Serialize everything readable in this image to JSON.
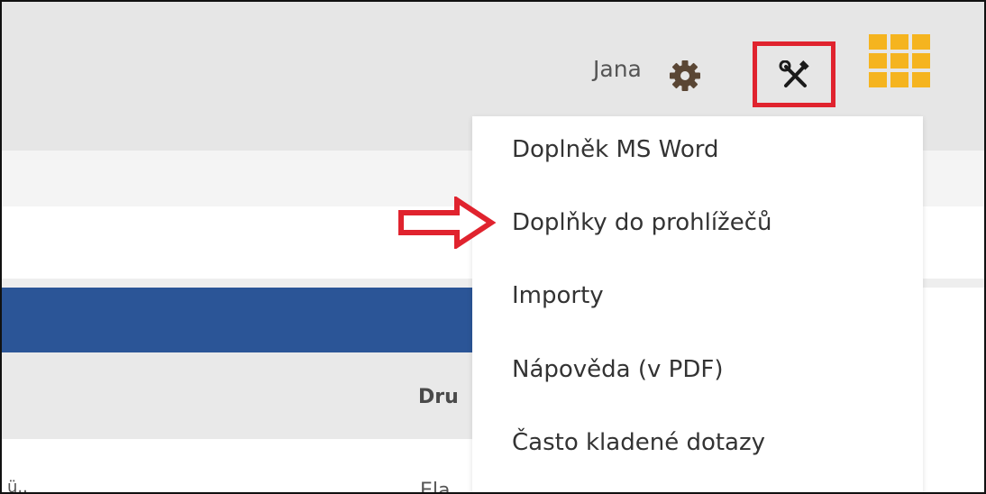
{
  "header": {
    "user_name": "Jana",
    "icons": {
      "settings": "gear-icon",
      "tools": "tools-icon",
      "apps": "apps-grid-icon"
    },
    "colors": {
      "highlight_box": "#e0232e",
      "apps_icon": "#f5b41f"
    }
  },
  "dropdown": {
    "items": [
      {
        "label": "Doplněk MS Word"
      },
      {
        "label": "Doplňky do prohlížečů"
      },
      {
        "label": "Importy"
      },
      {
        "label": "Nápověda (v PDF)"
      },
      {
        "label": "Často kladené dotazy"
      }
    ],
    "highlighted_item_index": 1
  },
  "table": {
    "column_header_partial": "Dru",
    "row_partial_left": "ü..",
    "row_partial_mid": "Ela"
  },
  "colors": {
    "nav_blue": "#2b5597",
    "arrow_red": "#e0232e"
  }
}
